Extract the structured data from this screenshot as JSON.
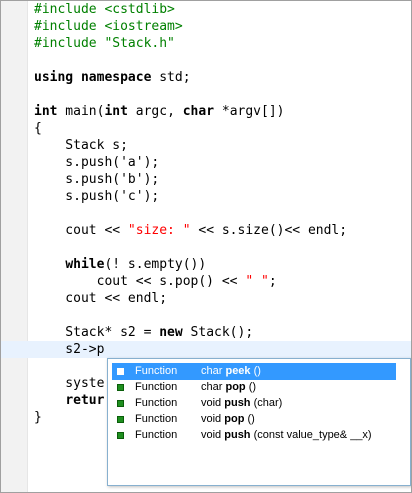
{
  "editor": {
    "lines": [
      {
        "parts": [
          {
            "cls": "pp",
            "text": "#include <cstdlib>"
          }
        ]
      },
      {
        "parts": [
          {
            "cls": "pp",
            "text": "#include <iostream>"
          }
        ]
      },
      {
        "parts": [
          {
            "cls": "pp",
            "text": "#include \"Stack.h\""
          }
        ]
      },
      {
        "parts": []
      },
      {
        "parts": [
          {
            "cls": "kw",
            "text": "using namespace"
          },
          {
            "cls": "",
            "text": " std;"
          }
        ]
      },
      {
        "parts": []
      },
      {
        "parts": [
          {
            "cls": "kw",
            "text": "int"
          },
          {
            "cls": "",
            "text": " main("
          },
          {
            "cls": "kw",
            "text": "int"
          },
          {
            "cls": "",
            "text": " argc, "
          },
          {
            "cls": "kw",
            "text": "char"
          },
          {
            "cls": "",
            "text": " *argv[])"
          }
        ]
      },
      {
        "parts": [
          {
            "cls": "",
            "text": "{"
          }
        ]
      },
      {
        "parts": [
          {
            "cls": "",
            "text": "    Stack s;"
          }
        ]
      },
      {
        "parts": [
          {
            "cls": "",
            "text": "    s.push('a');"
          }
        ]
      },
      {
        "parts": [
          {
            "cls": "",
            "text": "    s.push('b');"
          }
        ]
      },
      {
        "parts": [
          {
            "cls": "",
            "text": "    s.push('c');"
          }
        ]
      },
      {
        "parts": []
      },
      {
        "parts": [
          {
            "cls": "",
            "text": "    cout << "
          },
          {
            "cls": "str",
            "text": "\"size: \""
          },
          {
            "cls": "",
            "text": " << s.size()<< endl;"
          }
        ]
      },
      {
        "parts": []
      },
      {
        "parts": [
          {
            "cls": "",
            "text": "    "
          },
          {
            "cls": "kw",
            "text": "while"
          },
          {
            "cls": "",
            "text": "(! s.empty())"
          }
        ]
      },
      {
        "parts": [
          {
            "cls": "",
            "text": "        cout << s.pop() << "
          },
          {
            "cls": "str",
            "text": "\" \""
          },
          {
            "cls": "",
            "text": ";"
          }
        ]
      },
      {
        "parts": [
          {
            "cls": "",
            "text": "    cout << endl;"
          }
        ]
      },
      {
        "parts": []
      },
      {
        "parts": [
          {
            "cls": "",
            "text": "    Stack* s2 = "
          },
          {
            "cls": "kw",
            "text": "new"
          },
          {
            "cls": "",
            "text": " Stack();"
          }
        ]
      },
      {
        "parts": [
          {
            "cls": "",
            "text": "    s2->p"
          }
        ],
        "current": true
      },
      {
        "parts": []
      },
      {
        "parts": [
          {
            "cls": "",
            "text": "    syste"
          }
        ]
      },
      {
        "parts": [
          {
            "cls": "",
            "text": "    "
          },
          {
            "cls": "kw",
            "text": "retur"
          }
        ]
      },
      {
        "parts": [
          {
            "cls": "",
            "text": "}"
          }
        ]
      }
    ]
  },
  "autocomplete": {
    "items": [
      {
        "kind": "Function",
        "prefix": "char ",
        "name": "peek",
        "suffix": " ()",
        "selected": true
      },
      {
        "kind": "Function",
        "prefix": "char ",
        "name": "pop",
        "suffix": " ()",
        "selected": false
      },
      {
        "kind": "Function",
        "prefix": "void ",
        "name": "push",
        "suffix": " (char)",
        "selected": false
      },
      {
        "kind": "Function",
        "prefix": "void ",
        "name": "pop",
        "suffix": " ()",
        "selected": false
      },
      {
        "kind": "Function",
        "prefix": "void ",
        "name": "push",
        "suffix": " (const value_type& __x)",
        "selected": false
      }
    ]
  }
}
